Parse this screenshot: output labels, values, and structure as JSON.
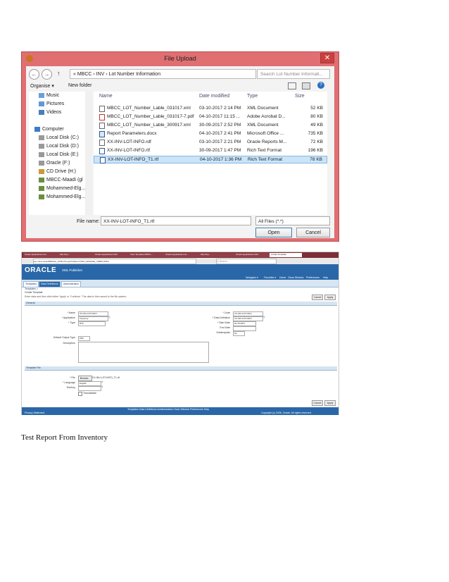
{
  "dialog": {
    "title": "File Upload",
    "close_glyph": "✕",
    "back_glyph": "←",
    "forward_glyph": "→",
    "up_glyph": "↑",
    "address_path": "« MBCC › INV › Lot Number Information",
    "search_placeholder": "Search Lot Number Informati...",
    "organise_label": "Organise ▾",
    "new_folder_label": "New folder",
    "tree": [
      "Music",
      "Pictures",
      "Videos",
      "Computer",
      "Local Disk (C:)",
      "Local Disk (D:)",
      "Local Disk (E:)",
      "Oracle (F:)",
      "CD Drive (H:)",
      "MBCC-Maadi (gl",
      "Mohammed-Elg...",
      "Mohammed-Elg..."
    ],
    "columns": {
      "name": "Name",
      "date": "Date modified",
      "type": "Type",
      "size": "Size"
    },
    "files": [
      {
        "name": "MBCC_LOT_Number_Lable_031017.xml",
        "date": "03-10-2017 2:14 PM",
        "type": "XML Document",
        "size": "52 KB"
      },
      {
        "name": "MBCC_LOT_Number_Lable_031017-7.pdf",
        "date": "04-10-2017 11:15 ...",
        "type": "Adobe Acrobat D...",
        "size": "80 KB"
      },
      {
        "name": "MBCC_LOT_Number_Lable_300917.xml",
        "date": "30-09-2017 2:52 PM",
        "type": "XML Document",
        "size": "49 KB"
      },
      {
        "name": "Report Parameters.docx",
        "date": "04-10-2017 2:41 PM",
        "type": "Microsoft Office ...",
        "size": "735 KB"
      },
      {
        "name": "XX-INV-LOT-INFO.rdf",
        "date": "03-10-2017 2:21 PM",
        "type": "Oracle Reports M...",
        "size": "72 KB"
      },
      {
        "name": "XX-INV-LOT-INFO.rtf",
        "date": "30-09-2017 1:47 PM",
        "type": "Rich Text Format",
        "size": "196 KB"
      },
      {
        "name": "XX-INV-LOT-INFO_T1.rtf",
        "date": "04-10-2017 1:36 PM",
        "type": "Rich Text Format",
        "size": "78 KB"
      }
    ],
    "file_name_label": "File name:",
    "file_name_value": "XX-INV-LOT-INFO_T1.rtf",
    "file_type_value": "All Files (*.*)",
    "open_label": "Open",
    "cancel_label": "Cancel"
  },
  "browser": {
    "tabs": [
      "Oracle Applications Ho...",
      "http://erp...",
      "Oracle Applications R12",
      "View Template MBCC-...",
      "Oracle Applications Ho...",
      "http://erp...",
      "Oracle Applications R12",
      "Create Template"
    ],
    "url": "erp.mbcc.local:8000/OA_HTML/OA.jsp?OAFunc=XDO_MANAGE_TEMPLATES",
    "search_placeholder": "Q Search",
    "logo": "ORACLE",
    "product": "XML Publisher",
    "header_links": [
      "Navigator ▾",
      "Favorites ▾",
      "Home",
      "Close Window",
      "Preferences",
      "Help"
    ],
    "nav_tabs": [
      "Templates",
      "Data Definitions",
      "Administration"
    ],
    "breadcrumb": "Templates >",
    "page_title": "Create Template",
    "instruction": "Enter data and then click either 'Apply' or 'Continue'. The data is then saved to the file system.",
    "cancel_label": "Cancel",
    "apply_label": "Apply",
    "general_header": "General",
    "fields_left": [
      {
        "label": "* Name",
        "value": "XX-INV-LOT-INFO"
      },
      {
        "label": "* Application",
        "value": "Inventory"
      },
      {
        "label": "* Type",
        "value": "RTF"
      }
    ],
    "fields_right": [
      {
        "label": "* Code",
        "value": "XX-INV-LOT-INFO"
      },
      {
        "label": "* Data Definition",
        "value": "XX-INV-LOT-INFO"
      },
      {
        "label": "* Start Date",
        "value": "04-10-2017"
      },
      {
        "label": "End Date",
        "value": ""
      },
      {
        "label": "Subtemplate",
        "value": "No"
      }
    ],
    "output_type_label": "Default Output Type",
    "output_type_value": "PDF",
    "description_label": "Description",
    "template_file_header": "Template File",
    "file_label": "* File",
    "browse_label": "Browse...",
    "file_value": "XX-INV-LOT-INFO_T1.rtf",
    "language_label": "* Language",
    "language_value": "English",
    "territory_label": "Territory",
    "translatable_label": "Translatable",
    "footer_links": "Templates  Data Definitions  Administration  Close Window  Preferences  Help",
    "privacy": "Privacy Statement",
    "copyright": "Copyright (c) 2006, Oracle. All rights reserved."
  },
  "caption": "Test Report From Inventory"
}
